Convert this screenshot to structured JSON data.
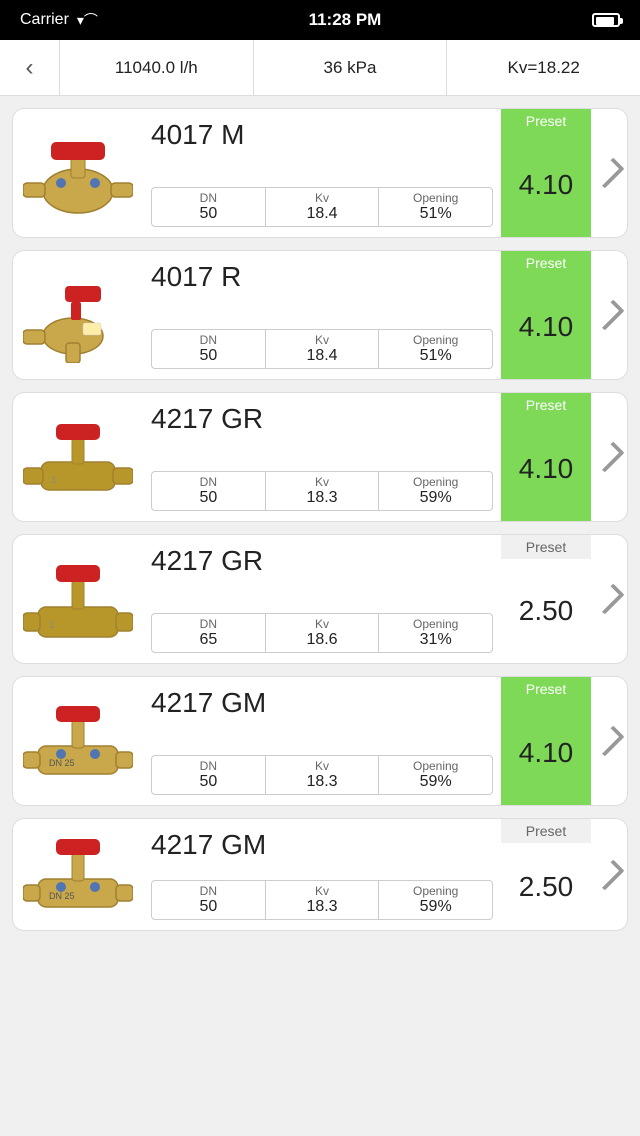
{
  "statusBar": {
    "carrier": "Carrier",
    "time": "11:28 PM"
  },
  "header": {
    "backLabel": "‹",
    "flow": "11040.0 l/h",
    "pressure": "36 kPa",
    "kv": "Kv=18.22"
  },
  "valves": [
    {
      "id": "v1",
      "name": "4017 M",
      "dn": "50",
      "kv": "18.4",
      "opening": "51%",
      "preset": "4.10",
      "highlight": true
    },
    {
      "id": "v2",
      "name": "4017 R",
      "dn": "50",
      "kv": "18.4",
      "opening": "51%",
      "preset": "4.10",
      "highlight": true
    },
    {
      "id": "v3",
      "name": "4217 GR",
      "dn": "50",
      "kv": "18.3",
      "opening": "59%",
      "preset": "4.10",
      "highlight": true
    },
    {
      "id": "v4",
      "name": "4217 GR",
      "dn": "65",
      "kv": "18.6",
      "opening": "31%",
      "preset": "2.50",
      "highlight": false
    },
    {
      "id": "v5",
      "name": "4217 GM",
      "dn": "50",
      "kv": "18.3",
      "opening": "59%",
      "preset": "4.10",
      "highlight": true
    },
    {
      "id": "v6",
      "name": "4217 GM",
      "dn": "50",
      "kv": "18.3",
      "opening": "59%",
      "preset": "2.50",
      "highlight": false,
      "partial": true
    }
  ],
  "labels": {
    "preset": "Preset",
    "dn": "DN",
    "kv": "Kv",
    "opening": "Opening"
  }
}
